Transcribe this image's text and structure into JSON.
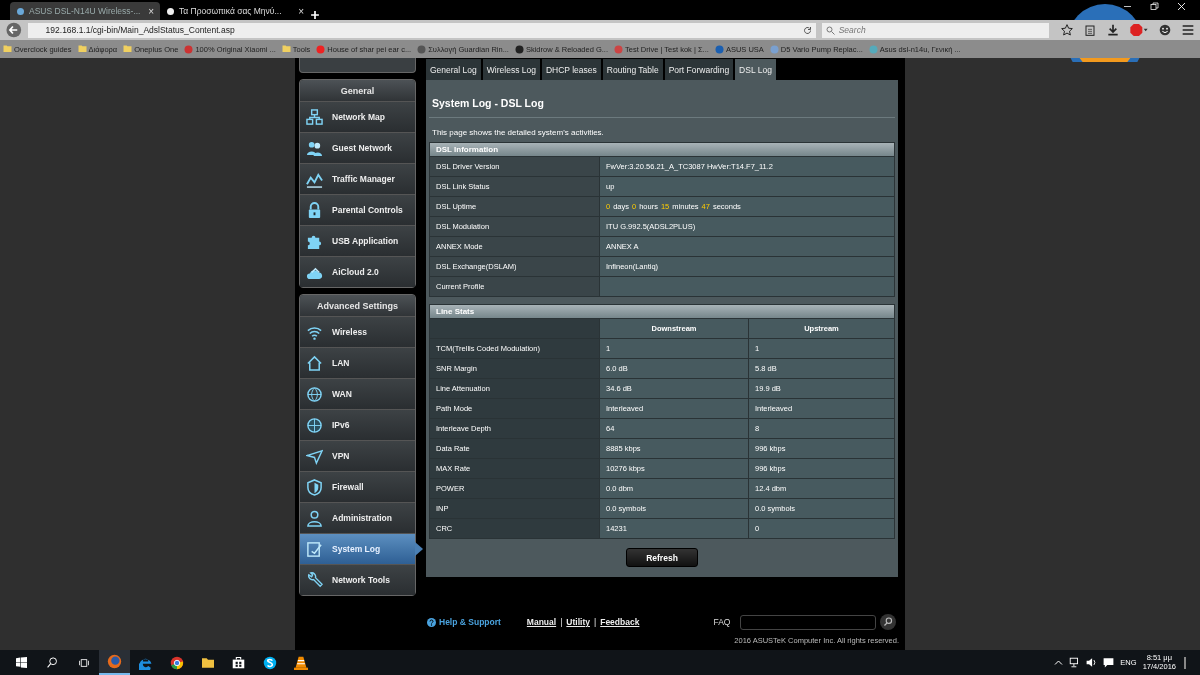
{
  "browser": {
    "tabs": [
      {
        "title": "ASUS DSL-N14U Wireless-...",
        "selected": true
      },
      {
        "title": "Τα Προσωπικά σας Μηνύ...",
        "selected": false
      }
    ],
    "close": "×",
    "address": "192.168.1.1/cgi-bin/Main_AdslStatus_Content.asp",
    "search": {
      "placeholder": "Search"
    },
    "bookmarks": [
      "Overclock guides",
      "Διάφορα",
      "Oneplus One",
      "100% Original Xiaomi ...",
      "Tools",
      "House of shar pei ear c...",
      "Συλλογή Guardian Rin...",
      "Skidrow & Reloaded G...",
      "Test Drive | Test kok | Σ...",
      "ASUS USA",
      "D5 Vario Pump Replac...",
      "Asus dsl-n14u, Γενική ..."
    ]
  },
  "sidebar": {
    "groups": [
      {
        "title": "General",
        "items": [
          {
            "label": "Network Map",
            "selected": false
          },
          {
            "label": "Guest Network",
            "selected": false
          },
          {
            "label": "Traffic Manager",
            "selected": false
          },
          {
            "label": "Parental Controls",
            "selected": false
          },
          {
            "label": "USB Application",
            "selected": false
          },
          {
            "label": "AiCloud 2.0",
            "selected": false
          }
        ]
      },
      {
        "title": "Advanced Settings",
        "items": [
          {
            "label": "Wireless",
            "selected": false
          },
          {
            "label": "LAN",
            "selected": false
          },
          {
            "label": "WAN",
            "selected": false
          },
          {
            "label": "IPv6",
            "selected": false
          },
          {
            "label": "VPN",
            "selected": false
          },
          {
            "label": "Firewall",
            "selected": false
          },
          {
            "label": "Administration",
            "selected": false
          },
          {
            "label": "System Log",
            "selected": true
          },
          {
            "label": "Network Tools",
            "selected": false
          }
        ]
      }
    ]
  },
  "tabs": [
    {
      "label": "General Log",
      "selected": false
    },
    {
      "label": "Wireless Log",
      "selected": false
    },
    {
      "label": "DHCP leases",
      "selected": false
    },
    {
      "label": "Routing Table",
      "selected": false
    },
    {
      "label": "Port Forwarding",
      "selected": false
    },
    {
      "label": "DSL Log",
      "selected": true
    }
  ],
  "page": {
    "title": "System Log - DSL Log",
    "description": "This page shows the detailed system's activities."
  },
  "dsl_information": {
    "title": "DSL Information",
    "rows": [
      {
        "label": "DSL Driver Version",
        "value": "FwVer:3.20.56.21_A_TC3087 HwVer:T14.F7_11.2"
      },
      {
        "label": "DSL Link Status",
        "value": "up"
      },
      {
        "label": "DSL Uptime",
        "parts": [
          {
            "kind": "number",
            "text": "0"
          },
          {
            "kind": "unit",
            "text": "days"
          },
          {
            "kind": "number",
            "text": "0"
          },
          {
            "kind": "unit",
            "text": "hours"
          },
          {
            "kind": "number",
            "text": "15"
          },
          {
            "kind": "unit",
            "text": "minutes"
          },
          {
            "kind": "number",
            "text": "47"
          },
          {
            "kind": "unit",
            "text": "seconds"
          }
        ]
      },
      {
        "label": "DSL Modulation",
        "value": "ITU G.992.5(ADSL2PLUS)"
      },
      {
        "label": "ANNEX Mode",
        "value": "ANNEX A"
      },
      {
        "label": "DSL Exchange(DSLAM)",
        "value": "Infineon(Lantiq)"
      },
      {
        "label": "Current Profile"
      }
    ]
  },
  "line_stats": {
    "title": "Line Stats",
    "columns": [
      "Downstream",
      "Upstream"
    ],
    "rows": [
      {
        "label": "TCM(Trellis Coded Modulation)",
        "downstream": "1",
        "upstream": "1"
      },
      {
        "label": "SNR Margin",
        "downstream": "6.0 dB",
        "upstream": "5.8 dB"
      },
      {
        "label": "Line Attenuation",
        "downstream": "34.6 dB",
        "upstream": "19.9 dB"
      },
      {
        "label": "Path Mode",
        "downstream": "Interleaved",
        "upstream": "Interleaved"
      },
      {
        "label": "Interleave Depth",
        "downstream": "64",
        "upstream": "8"
      },
      {
        "label": "Data Rate",
        "downstream": "8885 kbps",
        "upstream": "996 kbps"
      },
      {
        "label": "MAX Rate",
        "downstream": "10276 kbps",
        "upstream": "996 kbps"
      },
      {
        "label": "POWER",
        "downstream": "0.0 dbm",
        "upstream": "12.4 dbm"
      },
      {
        "label": "INP",
        "downstream": "0.0 symbols",
        "upstream": "0.0 symbols"
      },
      {
        "label": "CRC",
        "downstream": "14231",
        "upstream": "0"
      }
    ]
  },
  "refresh_button": "Refresh",
  "footer": {
    "help": "Help & Support",
    "links": [
      "Manual",
      "Utility",
      "Feedback"
    ],
    "separator": "|",
    "faq": "FAQ",
    "copyright": "2016 ASUSTeK Computer Inc. All rights reserved."
  },
  "taskbar": {
    "language": "ENG",
    "time": "8:51 μμ",
    "date": "17/4/2016"
  }
}
